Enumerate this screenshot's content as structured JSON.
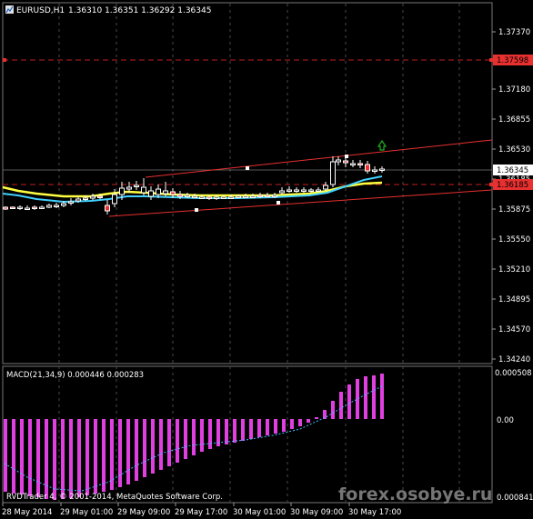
{
  "chart_header": {
    "symbol_icon": "chart-window-icon",
    "symbol": "EURUSD,H1",
    "ohlc": "1.36310 1.36351 1.36292 1.36345"
  },
  "price_axis": {
    "labels": [
      "1.37370",
      "1.37180",
      "1.36855",
      "1.36530",
      "1.36185",
      "1.35875",
      "1.35550",
      "1.35210",
      "1.34895",
      "1.34570",
      "1.34240"
    ],
    "current_price": "1.36345",
    "upper_level": "1.37598",
    "lower_level": "1.36185"
  },
  "macd_panel": {
    "label": "MACD(21,34,9) 0.000446 0.000283",
    "axis_top": "0.000508",
    "axis_zero": "0.00",
    "axis_bottom": "0.000841"
  },
  "time_axis": {
    "labels": [
      "28 May 2014",
      "29 May 01:00",
      "29 May 09:00",
      "29 May 17:00",
      "30 May 01:00",
      "30 May 09:00",
      "30 May 17:00"
    ]
  },
  "copyright": "RVDTrader 4, © 2001-2014, MetaQuotes Software Corp.",
  "watermark": "forex.osobye.ru",
  "colors": {
    "background": "#000000",
    "grid": "#3a3a3a",
    "dashed_red": "#d02020",
    "channel": "#e83030",
    "macd_hist": "#e040e0",
    "signal": "#40c0ff",
    "ma_fast": "#ffff40",
    "ma_slow": "#40d0ff",
    "up_arrow": "#20b020"
  }
}
